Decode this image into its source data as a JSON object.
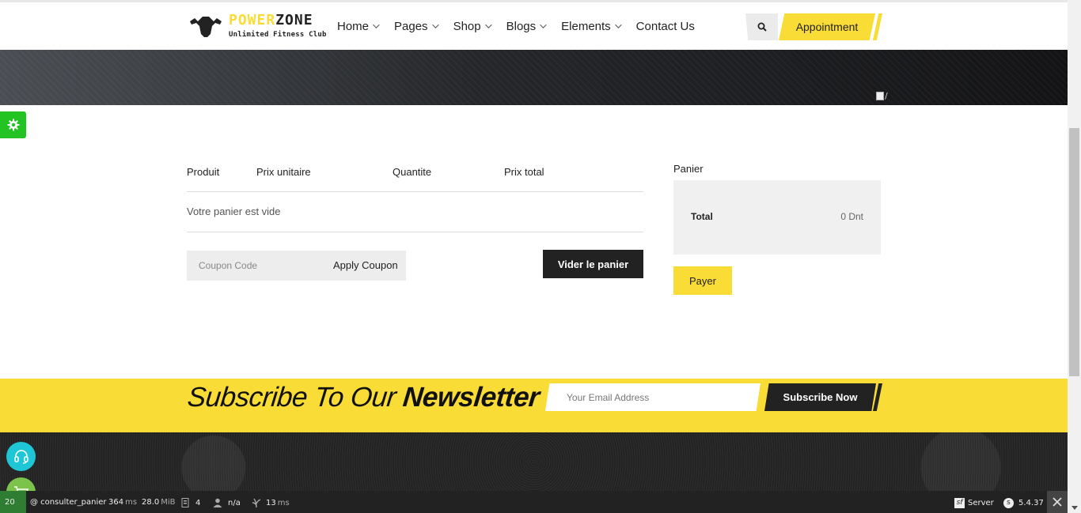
{
  "brand": {
    "name_part1": "POWER",
    "name_part2": "ZONE",
    "tagline": "Unlimited Fitness Club"
  },
  "nav": {
    "items": [
      {
        "label": "Home",
        "dropdown": true
      },
      {
        "label": "Pages",
        "dropdown": true
      },
      {
        "label": "Shop",
        "dropdown": true
      },
      {
        "label": "Blogs",
        "dropdown": true
      },
      {
        "label": "Elements",
        "dropdown": true
      },
      {
        "label": "Contact Us",
        "dropdown": false
      }
    ],
    "appointment_label": "Appointment"
  },
  "banner": {
    "broken_image_alt": "/"
  },
  "cart": {
    "columns": [
      "Produit",
      "Prix unitaire",
      "Quantite",
      "Prix total"
    ],
    "empty_message": "Votre panier est vide",
    "coupon_placeholder": "Coupon Code",
    "apply_coupon_label": "Apply Coupon",
    "clear_label": "Vider le panier"
  },
  "summary": {
    "title": "Panier",
    "total_label": "Total",
    "total_value": "0 Dnt",
    "pay_label": "Payer"
  },
  "newsletter": {
    "title_light": "Subscribe To Our",
    "title_bold": "Newsletter",
    "email_placeholder": "Your Email Address",
    "button_label": "Subscribe Now"
  },
  "debug_toolbar": {
    "status_code": "20",
    "route": "@ consulter_panier",
    "time_value": "364",
    "time_unit": "ms",
    "memory_value": "28.0",
    "memory_unit": "MiB",
    "queries_count": "4",
    "user": "n/a",
    "render_value": "13",
    "render_unit": "ms",
    "server_label": "Server",
    "symfony_version": "5.4.37"
  },
  "colors": {
    "accent": "#f9dc36",
    "dark": "#222222",
    "settings_green": "#22c322",
    "support_cyan": "#1fc6d6",
    "cart_green": "#7bc34a"
  }
}
